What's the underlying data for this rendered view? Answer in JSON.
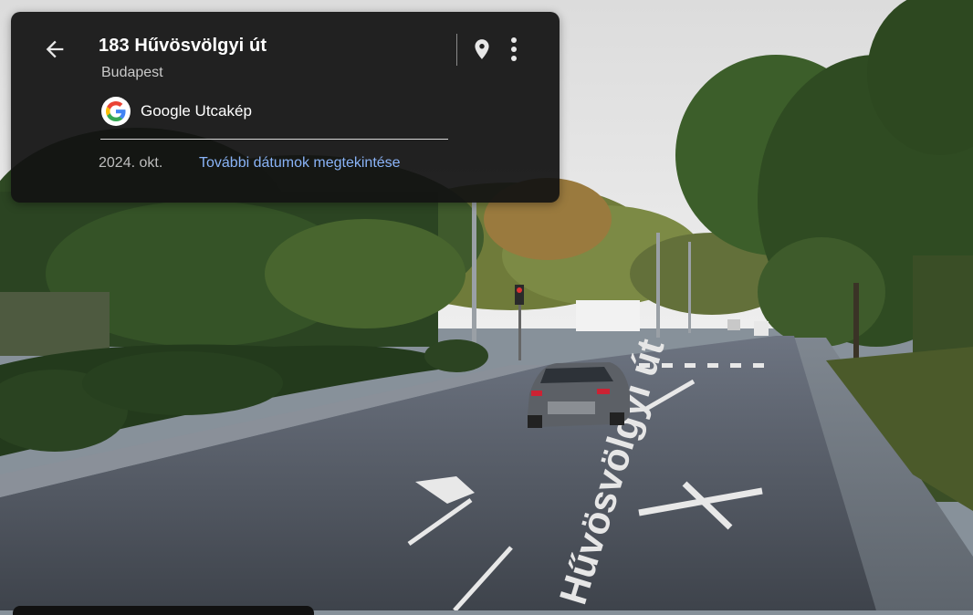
{
  "header": {
    "address": "183 Hűvösvölgyi út",
    "city": "Budapest"
  },
  "source": {
    "label": "Google Utcakép"
  },
  "capture": {
    "date": "2024. okt.",
    "more_dates_link": "További dátumok megtekintése"
  },
  "scene": {
    "road_marking_text": "Hűvösvölgyi út"
  },
  "icons": {
    "back": "arrow-back-icon",
    "pin": "map-pin-icon",
    "more": "more-vert-icon",
    "logo": "google-g-logo"
  },
  "colors": {
    "card_bg": "#121212",
    "link": "#8ab4f8",
    "title": "#ffffff",
    "secondary_text": "#c9c9c9"
  }
}
